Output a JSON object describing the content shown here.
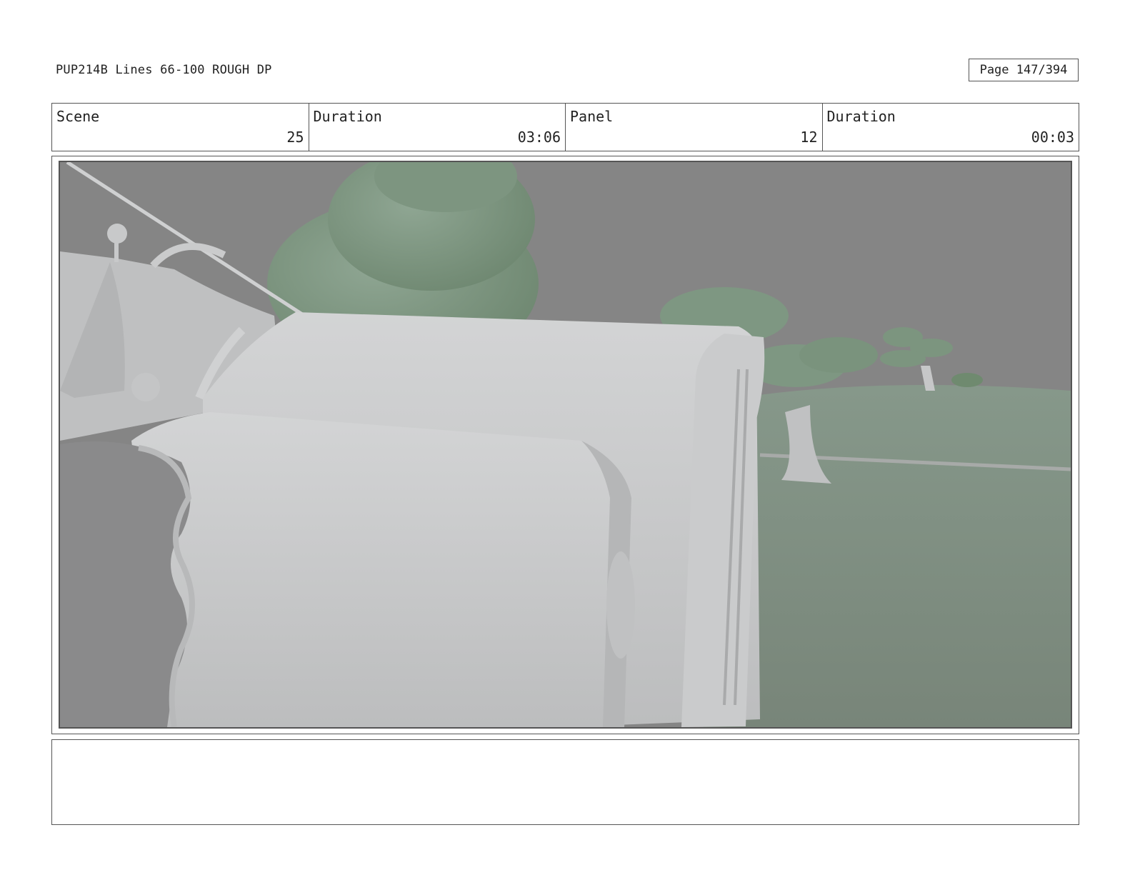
{
  "header": {
    "title": "PUP214B Lines 66-100 ROUGH DP",
    "page": "Page 147/394"
  },
  "info": {
    "scene_label": "Scene",
    "scene_value": "25",
    "scene_duration_label": "Duration",
    "scene_duration_value": "03:06",
    "panel_label": "Panel",
    "panel_value": "12",
    "panel_duration_label": "Duration",
    "panel_duration_value": "00:03"
  },
  "frame": {
    "image_subject": "3d-render-truck-hood-with-trees"
  },
  "colors": {
    "sky": "#858585",
    "ground": "#7b8a7e",
    "foliage": "#7c9680",
    "truck": "#c9cacb",
    "border": "#555555"
  },
  "notes": {
    "text": ""
  }
}
